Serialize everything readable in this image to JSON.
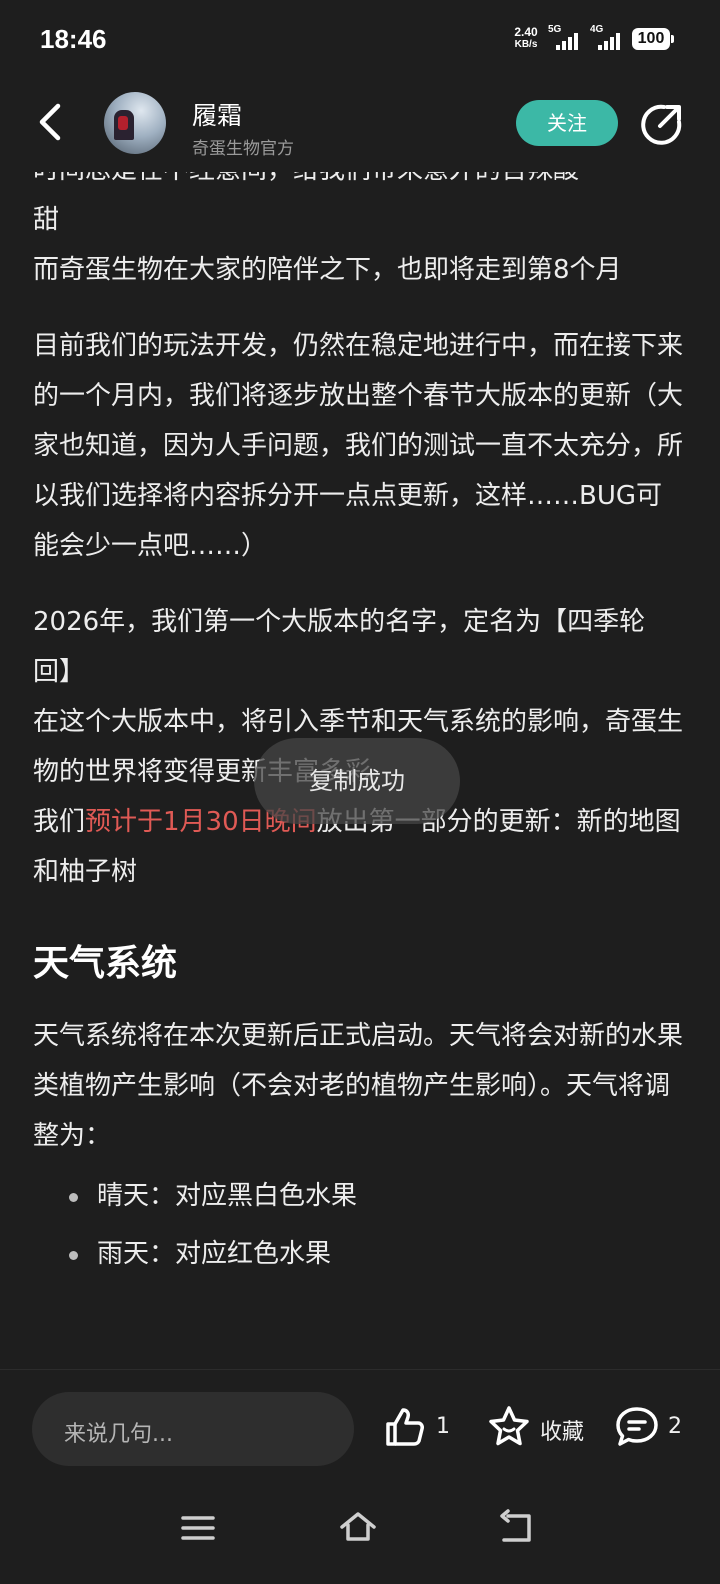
{
  "status_bar": {
    "time": "18:46",
    "net_speed_value": "2.40",
    "net_speed_unit": "KB/s",
    "sim1_label": "5G",
    "sim2_label": "4G",
    "battery": "100"
  },
  "header": {
    "user_name": "履霜",
    "user_subtitle": "奇蛋生物官方",
    "follow_label": "关注"
  },
  "article": {
    "cutoff_line": "时间总是在不经意间，给我们带来意外的苦辣酸",
    "p1_end": "甜",
    "p2": "而奇蛋生物在大家的陪伴之下，也即将走到第8个月",
    "p3": "目前我们的玩法开发，仍然在稳定地进行中，而在接下来的一个月内，我们将逐步放出整个春节大版本的更新（大家也知道，因为人手问题，我们的测试一直不太充分，所以我们选择将内容拆分开一点点更新，这样……BUG可能会少一点吧……）",
    "p4": "2026年，我们第一个大版本的名字，定名为【四季轮回】",
    "p5": "在这个大版本中，将引入季节和天气系统的影响，奇蛋生物的世界将变得更新丰富多彩",
    "p6_before": "我们",
    "p6_highlight": "预计于1月30日晚间",
    "p6_after": "放出第一部分的更新：新的地图和柚子树",
    "section_title": "天气系统",
    "p7": "天气系统将在本次更新后正式启动。天气将会对新的水果类植物产生影响（不会对老的植物产生影响）。天气将调整为：",
    "bullets": [
      "晴天：对应黑白色水果",
      "雨天：对应红色水果"
    ]
  },
  "toast": "复制成功",
  "bottom_bar": {
    "comment_placeholder": "来说几句...",
    "like_count": "1",
    "favorite_label": "收藏",
    "comment_count": "2"
  },
  "icons": {
    "back": "back-arrow-icon",
    "share": "share-icon",
    "like": "thumbs-up-icon",
    "favorite": "star-icon",
    "comment": "comment-bubble-icon",
    "menu": "menu-icon",
    "home": "home-icon",
    "return": "return-icon"
  },
  "colors": {
    "accent": "#3cb8a6",
    "highlight": "#e05a55",
    "background": "#1e1e1e"
  }
}
